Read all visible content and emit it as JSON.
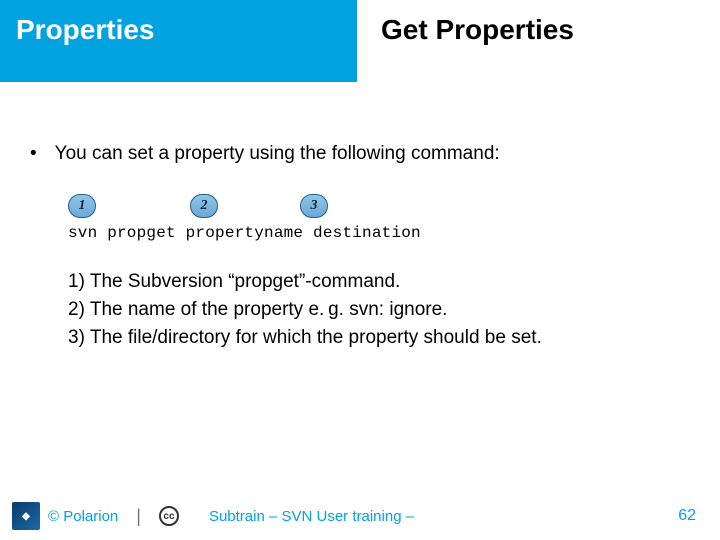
{
  "header": {
    "left": "Properties",
    "right": "Get Properties"
  },
  "body": {
    "bullet": "You can set a property using the following command:",
    "callouts": [
      "1",
      "2",
      "3"
    ],
    "command": "svn propget propertyname destination",
    "items": [
      "The Subversion “propget”-command.",
      "The name of the property e. g. svn: ignore.",
      "The file/directory for which the property should be set."
    ]
  },
  "footer": {
    "copyright": "© Polarion",
    "cc": "cc",
    "deck_title": "Subtrain – SVN User training –",
    "page": "62"
  }
}
